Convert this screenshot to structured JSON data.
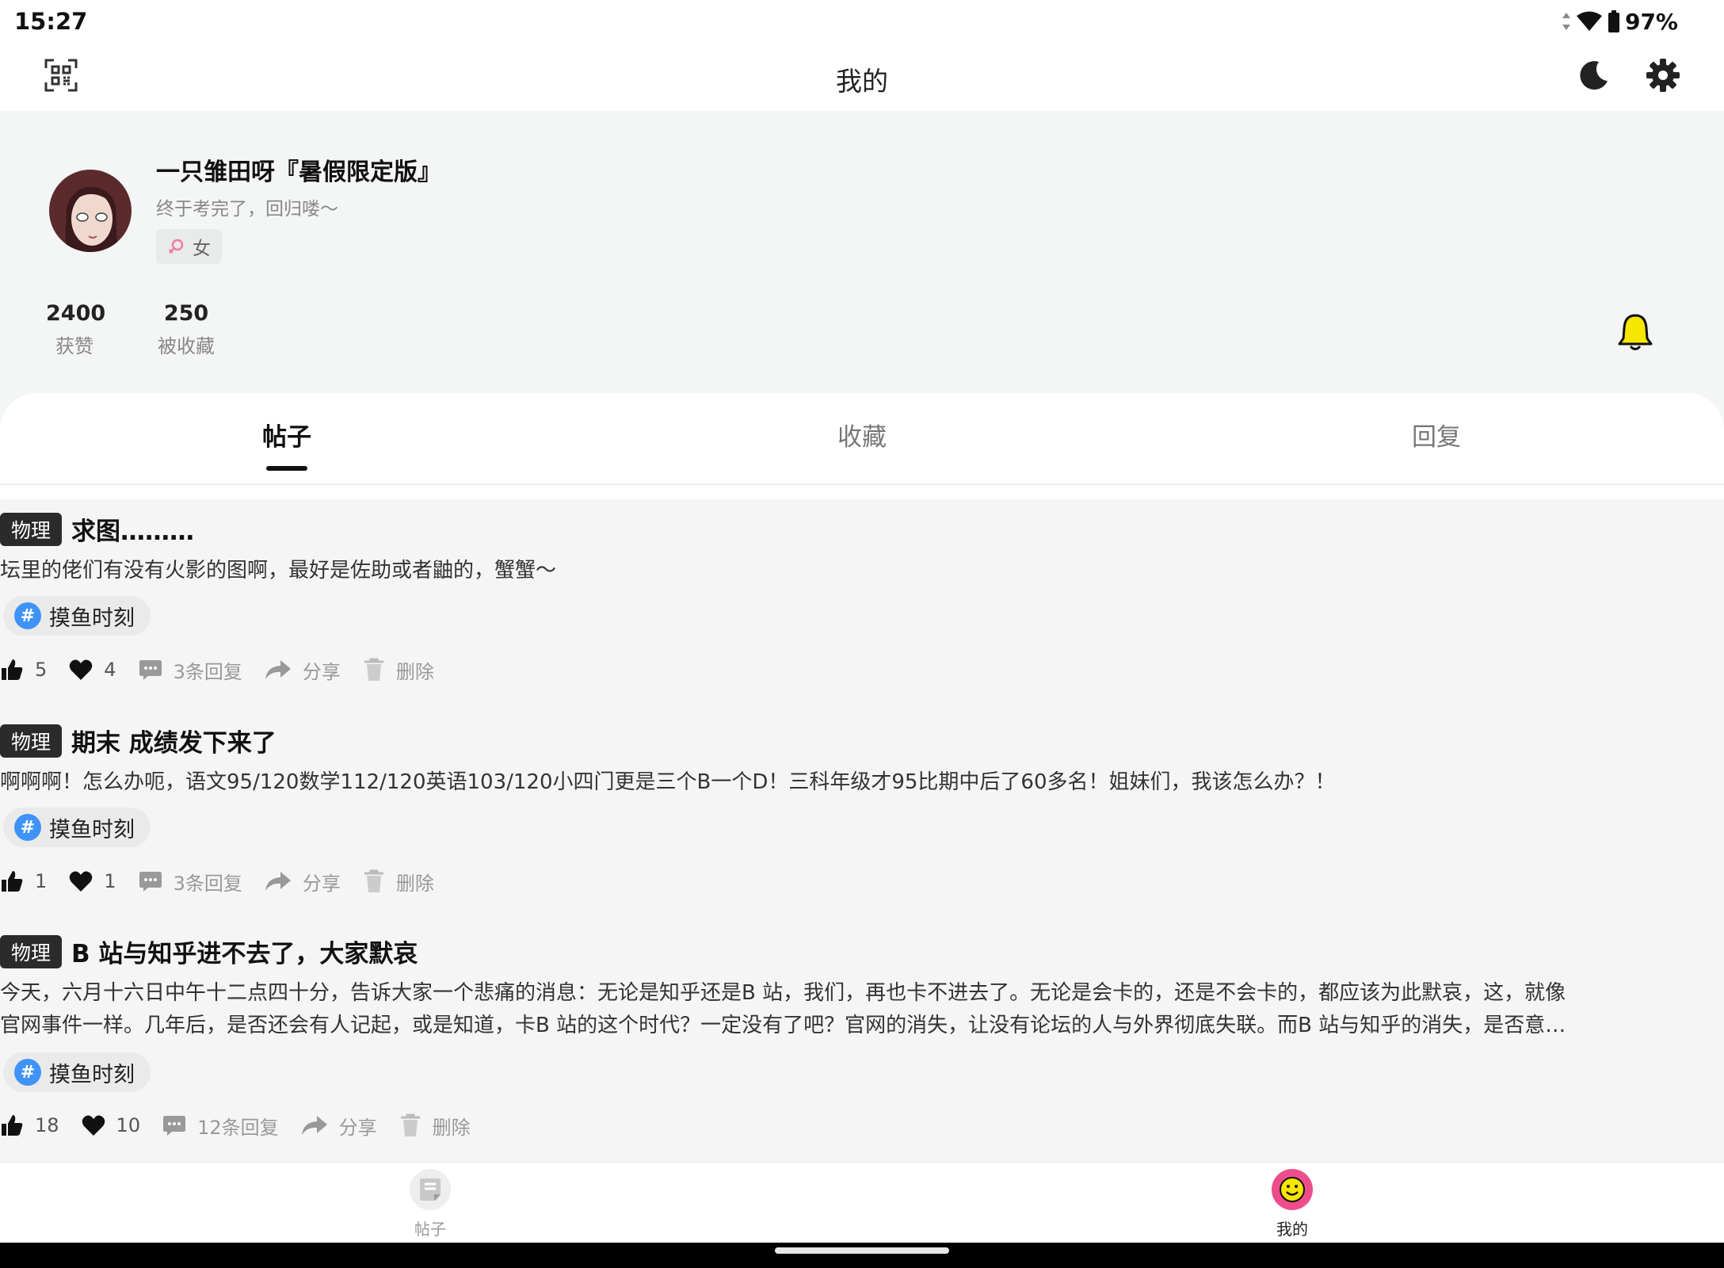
{
  "status_bar": {
    "time": "15:27",
    "battery": "97%"
  },
  "header": {
    "title": "我的"
  },
  "profile": {
    "nickname": "一只雏田呀『暑假限定版』",
    "signature": "终于考完了，回归喽～",
    "gender": "女",
    "stats": [
      {
        "value": "2400",
        "label": "获赞"
      },
      {
        "value": "250",
        "label": "被收藏"
      }
    ]
  },
  "tabs": [
    {
      "label": "帖子",
      "active": true
    },
    {
      "label": "收藏",
      "active": false
    },
    {
      "label": "回复",
      "active": false
    }
  ],
  "posts": [
    {
      "category": "物理",
      "title": "求图………",
      "body": "坛里的佬们有没有火影的图啊，最好是佐助或者鼬的，蟹蟹～",
      "tag": "摸鱼时刻",
      "likes": "5",
      "favorites": "4",
      "replies": "3条回复",
      "share": "分享",
      "delete": "删除"
    },
    {
      "category": "物理",
      "title": "期末 成绩发下来了",
      "body": "啊啊啊！怎么办呃，语文95/120数学112/120英语103/120小四门更是三个B一个D！三科年级才95比期中后了60多名！姐妹们，我该怎么办？！",
      "tag": "摸鱼时刻",
      "likes": "1",
      "favorites": "1",
      "replies": "3条回复",
      "share": "分享",
      "delete": "删除"
    },
    {
      "category": "物理",
      "title": "B 站与知乎进不去了，大家默哀",
      "body_line1": "今天，六月十六日中午十二点四十分，告诉大家一个悲痛的消息：无论是知乎还是B 站，我们，再也卡不进去了。无论是会卡的，还是不会卡的，都应该为此默哀，这，就像",
      "body_line2": "官网事件一样。几年后，是否还会有人记起，或是知道，卡B 站的这个时代？一定没有了吧？官网的消失，让没有论坛的人与外界彻底失联。而B 站与知乎的消失，是否意…",
      "tag": "摸鱼时刻",
      "likes": "18",
      "favorites": "10",
      "replies": "12条回复",
      "share": "分享",
      "delete": "删除"
    }
  ],
  "bottom_nav": [
    {
      "label": "帖子",
      "icon": "posts-icon",
      "active": false
    },
    {
      "label": "我的",
      "icon": "smiley-icon",
      "active": true
    }
  ],
  "colors": {
    "accent_blue": "#3f93f7",
    "bell_yellow": "#f7e600",
    "nav_active_pink": "#ee4d8b",
    "badge_dark": "#2b2b2b"
  }
}
